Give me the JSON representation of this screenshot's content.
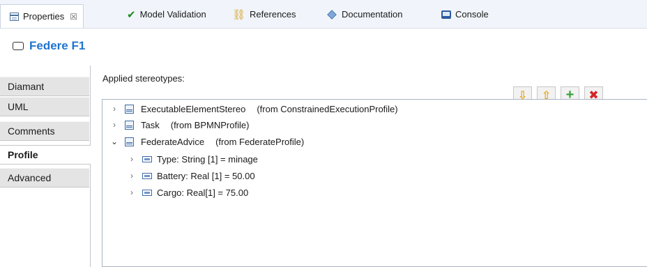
{
  "tabs": [
    {
      "label": "Properties",
      "close": "☒",
      "icon": "properties-icon"
    },
    {
      "label": "Model Validation",
      "icon": "checkmark-icon"
    },
    {
      "label": "References",
      "icon": "references-icon"
    },
    {
      "label": "Documentation",
      "icon": "documentation-icon"
    },
    {
      "label": "Console",
      "icon": "console-icon"
    }
  ],
  "title": "Federe F1",
  "categories": [
    {
      "label": "Diamant",
      "selected": false
    },
    {
      "label": "UML",
      "selected": false
    },
    {
      "label": "Comments",
      "selected": false
    },
    {
      "label": "Profile",
      "selected": true
    },
    {
      "label": "Advanced",
      "selected": false
    }
  ],
  "applied_label": "Applied stereotypes:",
  "toolbar": {
    "down": "⇩",
    "up": "⇧",
    "add": "+",
    "delete": "✖"
  },
  "tree": {
    "stereotypes": [
      {
        "name": "ExecutableElementStereo",
        "from": "(from ConstrainedExecutionProfile)",
        "expanded": false
      },
      {
        "name": "Task",
        "from": "(from BPMNProfile)",
        "expanded": false
      },
      {
        "name": "FederateAdvice",
        "from": "(from FederateProfile)",
        "expanded": true
      }
    ],
    "properties": [
      {
        "text": "Type: String [1] = minage"
      },
      {
        "text": "Battery: Real [1] = 50.00"
      },
      {
        "text": "Cargo: Real[1] = 75.00"
      }
    ],
    "chevron_closed": "›",
    "chevron_open": "⌄"
  },
  "colors": {
    "title": "#1f74d0",
    "tabbar_bg": "#f1f5fb",
    "category_bg": "#e4e4e4",
    "arrow_btn": "#e7a414",
    "add_btn": "#39a13a",
    "delete_btn": "#d42424"
  }
}
